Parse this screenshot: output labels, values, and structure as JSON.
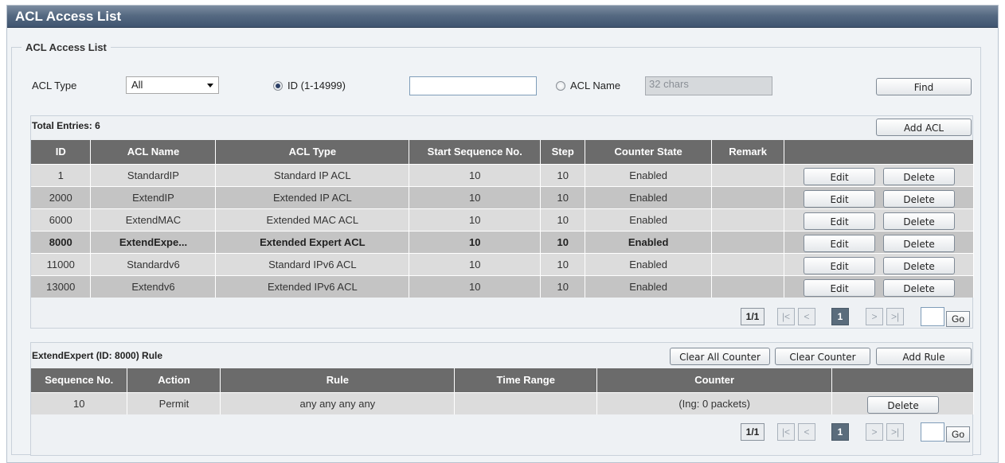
{
  "window": {
    "title": "ACL Access List"
  },
  "fieldset": {
    "legend": "ACL Access List"
  },
  "filter": {
    "acl_type_label": "ACL Type",
    "acl_type_value": "All",
    "id_radio_label": "ID (1-14999)",
    "id_value": "",
    "name_radio_label": "ACL Name",
    "name_placeholder": "32 chars",
    "find_label": "Find"
  },
  "acl_list": {
    "total_label": "Total Entries: 6",
    "add_label": "Add ACL",
    "columns": [
      "ID",
      "ACL Name",
      "ACL Type",
      "Start Sequence No.",
      "Step",
      "Counter State",
      "Remark",
      ""
    ],
    "rows": [
      {
        "id": "1",
        "name": "StandardIP",
        "type": "Standard IP ACL",
        "start": "10",
        "step": "10",
        "state": "Enabled",
        "remark": "",
        "edit": "Edit",
        "delete": "Delete"
      },
      {
        "id": "2000",
        "name": "ExtendIP",
        "type": "Extended IP ACL",
        "start": "10",
        "step": "10",
        "state": "Enabled",
        "remark": "",
        "edit": "Edit",
        "delete": "Delete"
      },
      {
        "id": "6000",
        "name": "ExtendMAC",
        "type": "Extended MAC ACL",
        "start": "10",
        "step": "10",
        "state": "Enabled",
        "remark": "",
        "edit": "Edit",
        "delete": "Delete"
      },
      {
        "id": "8000",
        "name": "ExtendExpe...",
        "type": "Extended Expert ACL",
        "start": "10",
        "step": "10",
        "state": "Enabled",
        "remark": "",
        "edit": "Edit",
        "delete": "Delete"
      },
      {
        "id": "11000",
        "name": "Standardv6",
        "type": "Standard IPv6 ACL",
        "start": "10",
        "step": "10",
        "state": "Enabled",
        "remark": "",
        "edit": "Edit",
        "delete": "Delete"
      },
      {
        "id": "13000",
        "name": "Extendv6",
        "type": "Extended IPv6 ACL",
        "start": "10",
        "step": "10",
        "state": "Enabled",
        "remark": "",
        "edit": "Edit",
        "delete": "Delete"
      }
    ],
    "pager": {
      "count": "1/1",
      "first": "|<",
      "prev": "<",
      "current": "1",
      "next": ">",
      "last": ">|",
      "go": "Go"
    }
  },
  "rules": {
    "title": "ExtendExpert (ID: 8000) Rule",
    "clear_all_label": "Clear All Counter",
    "clear_label": "Clear Counter",
    "add_label": "Add Rule",
    "columns": [
      "Sequence No.",
      "Action",
      "Rule",
      "Time Range",
      "Counter",
      ""
    ],
    "rows": [
      {
        "seq": "10",
        "action": "Permit",
        "rule": "any any any any",
        "time": "",
        "counter": "(Ing: 0 packets)",
        "delete": "Delete"
      }
    ],
    "pager": {
      "count": "1/1",
      "first": "|<",
      "prev": "<",
      "current": "1",
      "next": ">",
      "last": ">|",
      "go": "Go"
    }
  }
}
